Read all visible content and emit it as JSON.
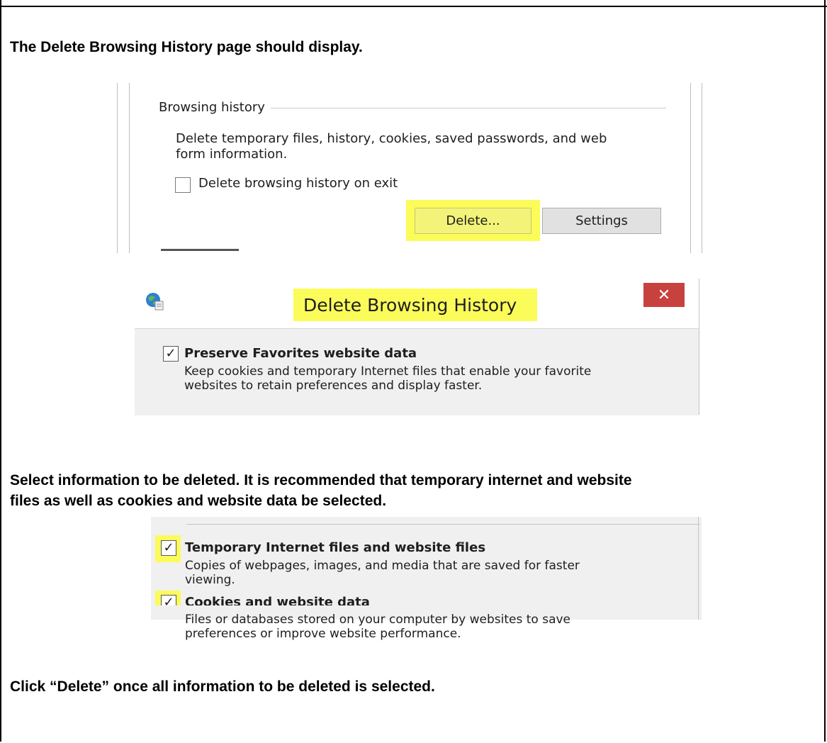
{
  "doc": {
    "step1": "The Delete Browsing History page should display.",
    "step2_line1": "Select information to be deleted. It is recommended that temporary internet and website",
    "step2_line2": "files as well as cookies and website data be selected.",
    "step3": "Click “Delete” once all information to be deleted is selected."
  },
  "browsing_history": {
    "legend": "Browsing history",
    "desc_line1": "Delete temporary files, history, cookies, saved passwords, and web",
    "desc_line2": "form information.",
    "checkbox_label": "Delete browsing history on exit",
    "checkbox_checked": false,
    "delete_button": "Delete...",
    "settings_button": "Settings"
  },
  "dialog": {
    "title": "Delete Browsing History",
    "close_glyph": "✕",
    "icon": "ie-globe-icon",
    "options": [
      {
        "title": "Preserve Favorites website data",
        "desc_line1": "Keep cookies and temporary Internet files that enable your favorite",
        "desc_line2": "websites to retain preferences and display faster.",
        "checked": true
      }
    ]
  },
  "dialog_options": [
    {
      "title": "Temporary Internet files and website files",
      "desc_line1": "Copies of webpages, images, and media that are saved for faster",
      "desc_line2": "viewing.",
      "checked": true
    },
    {
      "title": "Cookies and website data",
      "desc_line1": "Files or databases stored on your computer by websites to save",
      "desc_line2": "preferences or improve website performance.",
      "checked": true
    }
  ],
  "colors": {
    "highlight": "#fbfb5a",
    "close_red": "#c7413f",
    "dialog_bg": "#f0f0f0"
  }
}
